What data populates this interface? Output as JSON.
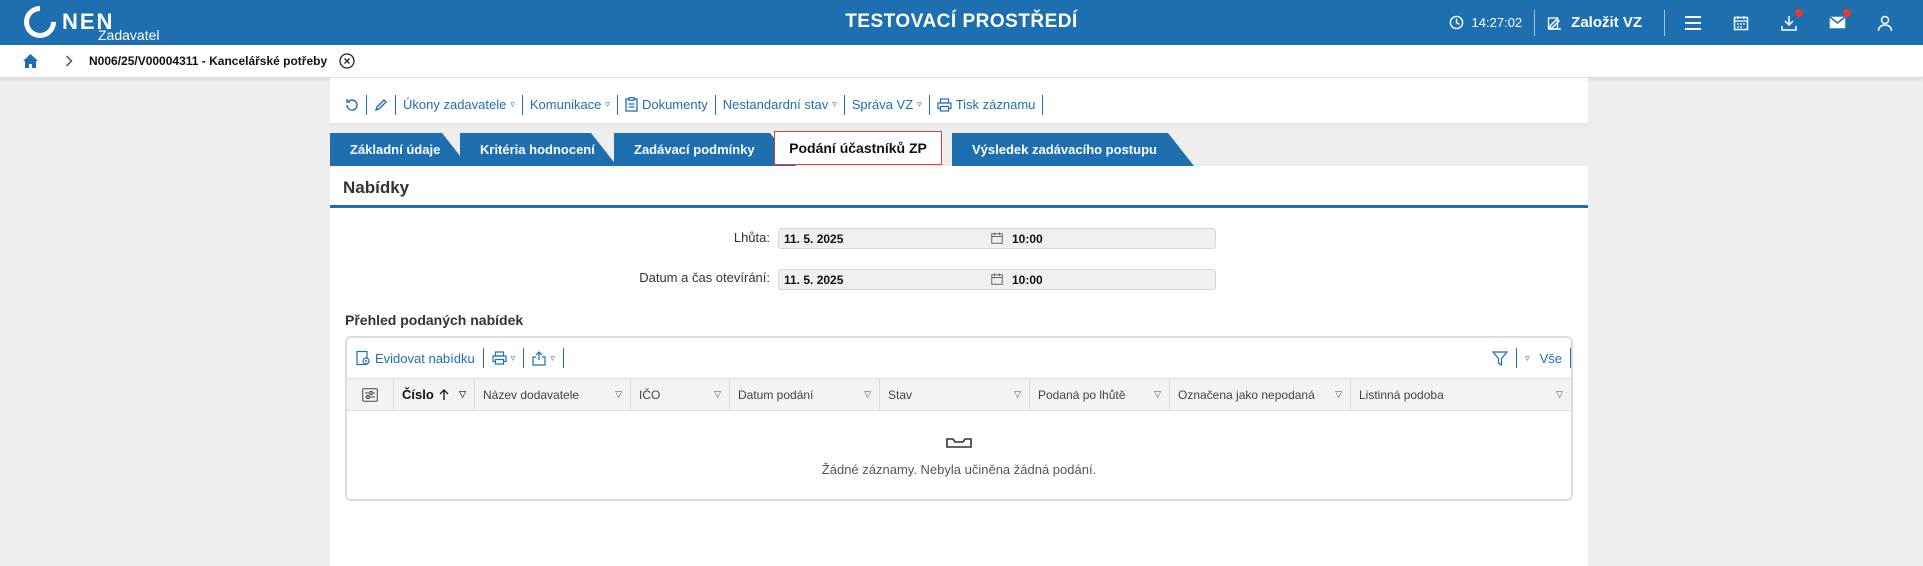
{
  "header": {
    "logo_text": "NEN",
    "logo_sub": "Zadavatel",
    "env_title": "TESTOVACÍ PROSTŘEDÍ",
    "time": "14:27:02",
    "new_vz_label": "Založit VZ"
  },
  "breadcrumb": {
    "item": "N006/25/V00004311 - Kancelářské potřeby"
  },
  "toolbar": {
    "items": [
      {
        "label": "Úkony zadavatele",
        "caret": "▿"
      },
      {
        "label": "Komunikace",
        "caret": "▿"
      },
      {
        "label": "Dokumenty"
      },
      {
        "label": "Nestandardní stav",
        "caret": "▿"
      },
      {
        "label": "Správa VZ",
        "caret": "▿"
      },
      {
        "label": "Tisk záznamu"
      }
    ]
  },
  "tabs": [
    {
      "label": "Základní údaje"
    },
    {
      "label": "Kritéria hodnocení"
    },
    {
      "label": "Zadávací podmínky"
    },
    {
      "label": "Podání účastníků ZP"
    },
    {
      "label": "Výsledek zadávacího postupu"
    }
  ],
  "section": {
    "title": "Nabídky",
    "fields": [
      {
        "label": "Lhůta:",
        "date": "11. 5. 2025",
        "time": "10:00"
      },
      {
        "label": "Datum a čas otevírání:",
        "date": "11. 5. 2025",
        "time": "10:00"
      }
    ]
  },
  "grid": {
    "title": "Přehled podaných nabídek",
    "evidovat_label": "Evidovat nabídku",
    "all_label": "Vše",
    "columns": [
      "Číslo",
      "Název dodavatele",
      "IČO",
      "Datum podání",
      "Stav",
      "Podaná po lhůtě",
      "Označena jako nepodaná",
      "Listinná podoba"
    ],
    "empty_text": "Žádné záznamy. Nebyla učiněna žádná podání."
  },
  "colors": {
    "brand": "#1e6fb0",
    "active_tab_border": "#e53935",
    "badge": "#e53935"
  }
}
